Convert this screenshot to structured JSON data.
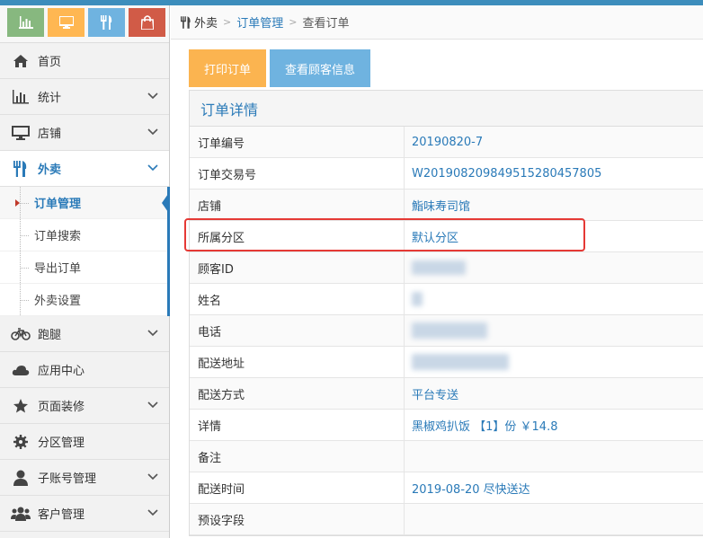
{
  "colors": {
    "accent": "#2a7ab8",
    "red_highlight": "#e53935"
  },
  "quick_buttons": [
    {
      "icon": "bar-chart-icon",
      "color": "#87b87f"
    },
    {
      "icon": "monitor-icon",
      "color": "#ffb752"
    },
    {
      "icon": "fork-knife-icon",
      "color": "#6fb3e0"
    },
    {
      "icon": "shopping-bag-icon",
      "color": "#d15b47"
    }
  ],
  "sidebar": {
    "items": [
      {
        "label": "首页",
        "icon": "home-icon"
      },
      {
        "label": "统计",
        "icon": "bar-chart-icon"
      },
      {
        "label": "店铺",
        "icon": "monitor-icon"
      },
      {
        "label": "外卖",
        "icon": "fork-knife-icon"
      },
      {
        "label": "跑腿",
        "icon": "bicycle-icon"
      },
      {
        "label": "应用中心",
        "icon": "cloud-icon"
      },
      {
        "label": "页面装修",
        "icon": "star-icon"
      },
      {
        "label": "分区管理",
        "icon": "gear-icon"
      },
      {
        "label": "子账号管理",
        "icon": "user-icon"
      },
      {
        "label": "客户管理",
        "icon": "users-icon"
      }
    ],
    "sub_items": [
      "订单管理",
      "订单搜索",
      "导出订单",
      "外卖设置"
    ]
  },
  "breadcrumb": {
    "root": "外卖",
    "parent": "订单管理",
    "current": "查看订单"
  },
  "buttons": {
    "print": "打印订单",
    "customer": "查看顾客信息"
  },
  "panel": {
    "title": "订单详情",
    "rows": [
      {
        "label": "订单编号",
        "value": "20190820-7"
      },
      {
        "label": "订单交易号",
        "value": "W201908209849515280457805"
      },
      {
        "label": "店铺",
        "value": "鮨味寿司馆"
      },
      {
        "label": "所属分区",
        "value": "默认分区"
      },
      {
        "label": "顾客ID",
        "value": ""
      },
      {
        "label": "姓名",
        "value": ""
      },
      {
        "label": "电话",
        "value": ""
      },
      {
        "label": "配送地址",
        "value": ""
      },
      {
        "label": "配送方式",
        "value": "平台专送"
      },
      {
        "label": "详情",
        "value": "黑椒鸡扒饭 【1】份 ￥14.8"
      },
      {
        "label": "备注",
        "value": ""
      },
      {
        "label": "配送时间",
        "value": "2019-08-20 尽快送达"
      },
      {
        "label": "预设字段",
        "value": ""
      }
    ]
  }
}
